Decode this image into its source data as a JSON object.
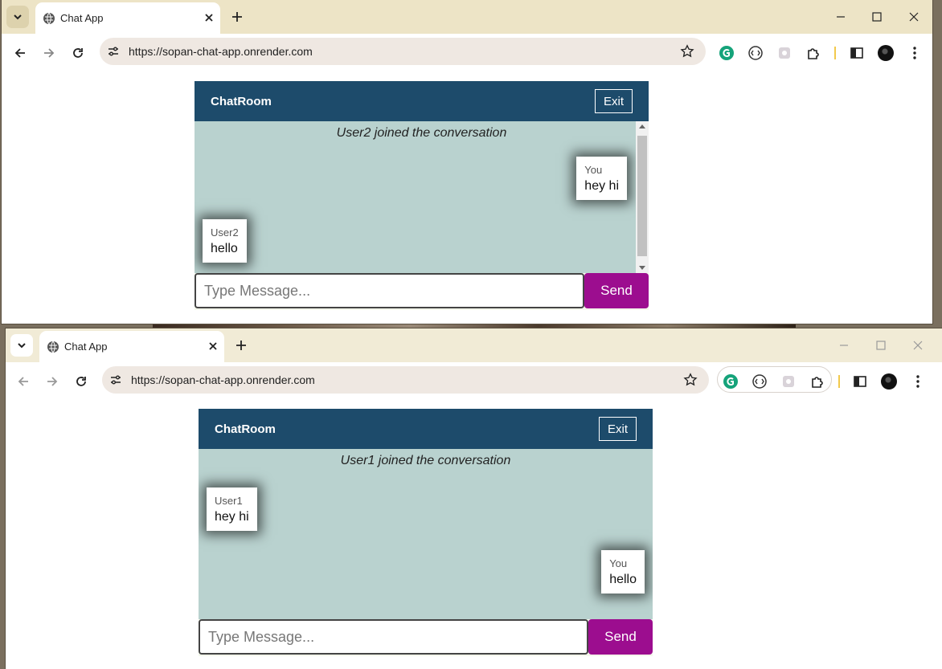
{
  "windows": [
    {
      "tab_title": "Chat App",
      "url": "https://sopan-chat-app.onrender.com",
      "chat": {
        "title": "ChatRoom",
        "exit_label": "Exit",
        "notice": "User2 joined the conversation",
        "messages": [
          {
            "sender": "You",
            "text": "hey hi",
            "side": "right"
          },
          {
            "sender": "User2",
            "text": "hello",
            "side": "left"
          }
        ],
        "input_placeholder": "Type Message...",
        "send_label": "Send"
      }
    },
    {
      "tab_title": "Chat App",
      "url": "https://sopan-chat-app.onrender.com",
      "chat": {
        "title": "ChatRoom",
        "exit_label": "Exit",
        "notice": "User1 joined the conversation",
        "messages": [
          {
            "sender": "User1",
            "text": "hey hi",
            "side": "left"
          },
          {
            "sender": "You",
            "text": "hello",
            "side": "right"
          }
        ],
        "input_placeholder": "Type Message...",
        "send_label": "Send"
      }
    }
  ],
  "colors": {
    "header": "#1d4b6b",
    "messages_bg": "#b9d2cf",
    "send_button": "#9c0d8f"
  },
  "icons": [
    "tab-list-icon",
    "globe-icon",
    "close-tab-icon",
    "new-tab-icon",
    "minimize-icon",
    "maximize-icon",
    "close-window-icon",
    "back-icon",
    "forward-icon",
    "reload-icon",
    "site-info-icon",
    "bookmark-star-icon",
    "grammarly-extension-icon",
    "extension-icon",
    "puzzle-extensions-icon",
    "side-panel-icon",
    "profile-avatar",
    "more-menu-icon"
  ]
}
